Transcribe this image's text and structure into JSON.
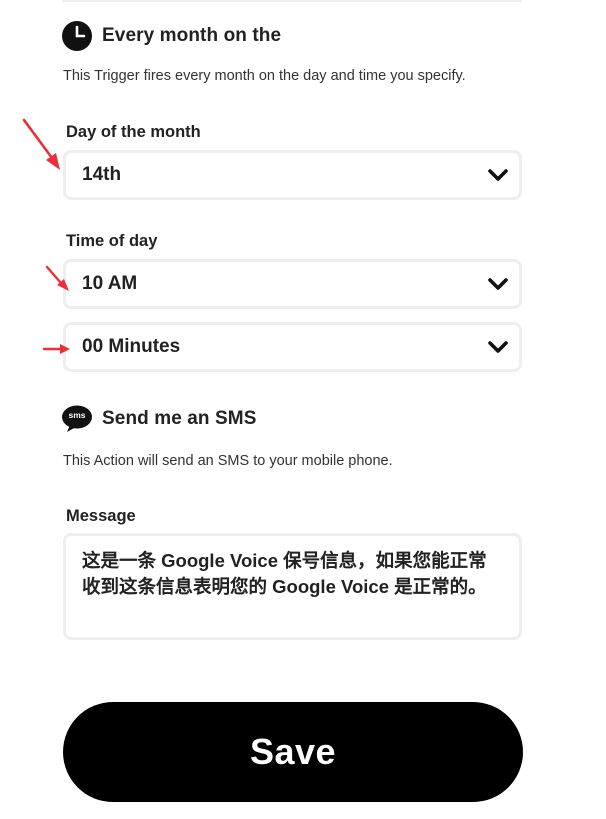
{
  "trigger": {
    "icon": "clock-icon",
    "title": "Every month on the",
    "description": "This Trigger fires every month on the day and time you specify.",
    "day_label": "Day of the month",
    "day_value": "14th",
    "time_label": "Time of day",
    "hour_value": "10 AM",
    "minute_value": "00 Minutes"
  },
  "action": {
    "icon": "sms-icon",
    "icon_text": "sms",
    "title": "Send me an SMS",
    "description": "This Action will send an SMS to your mobile phone.",
    "message_label": "Message",
    "message_value": "这是一条 Google Voice 保号信息，如果您能正常收到这条信息表明您的 Google Voice 是正常的。"
  },
  "save_label": "Save",
  "colors": {
    "annotation_arrow": "#e8303a",
    "button_bg": "#000000",
    "field_border": "#eeeeee"
  }
}
